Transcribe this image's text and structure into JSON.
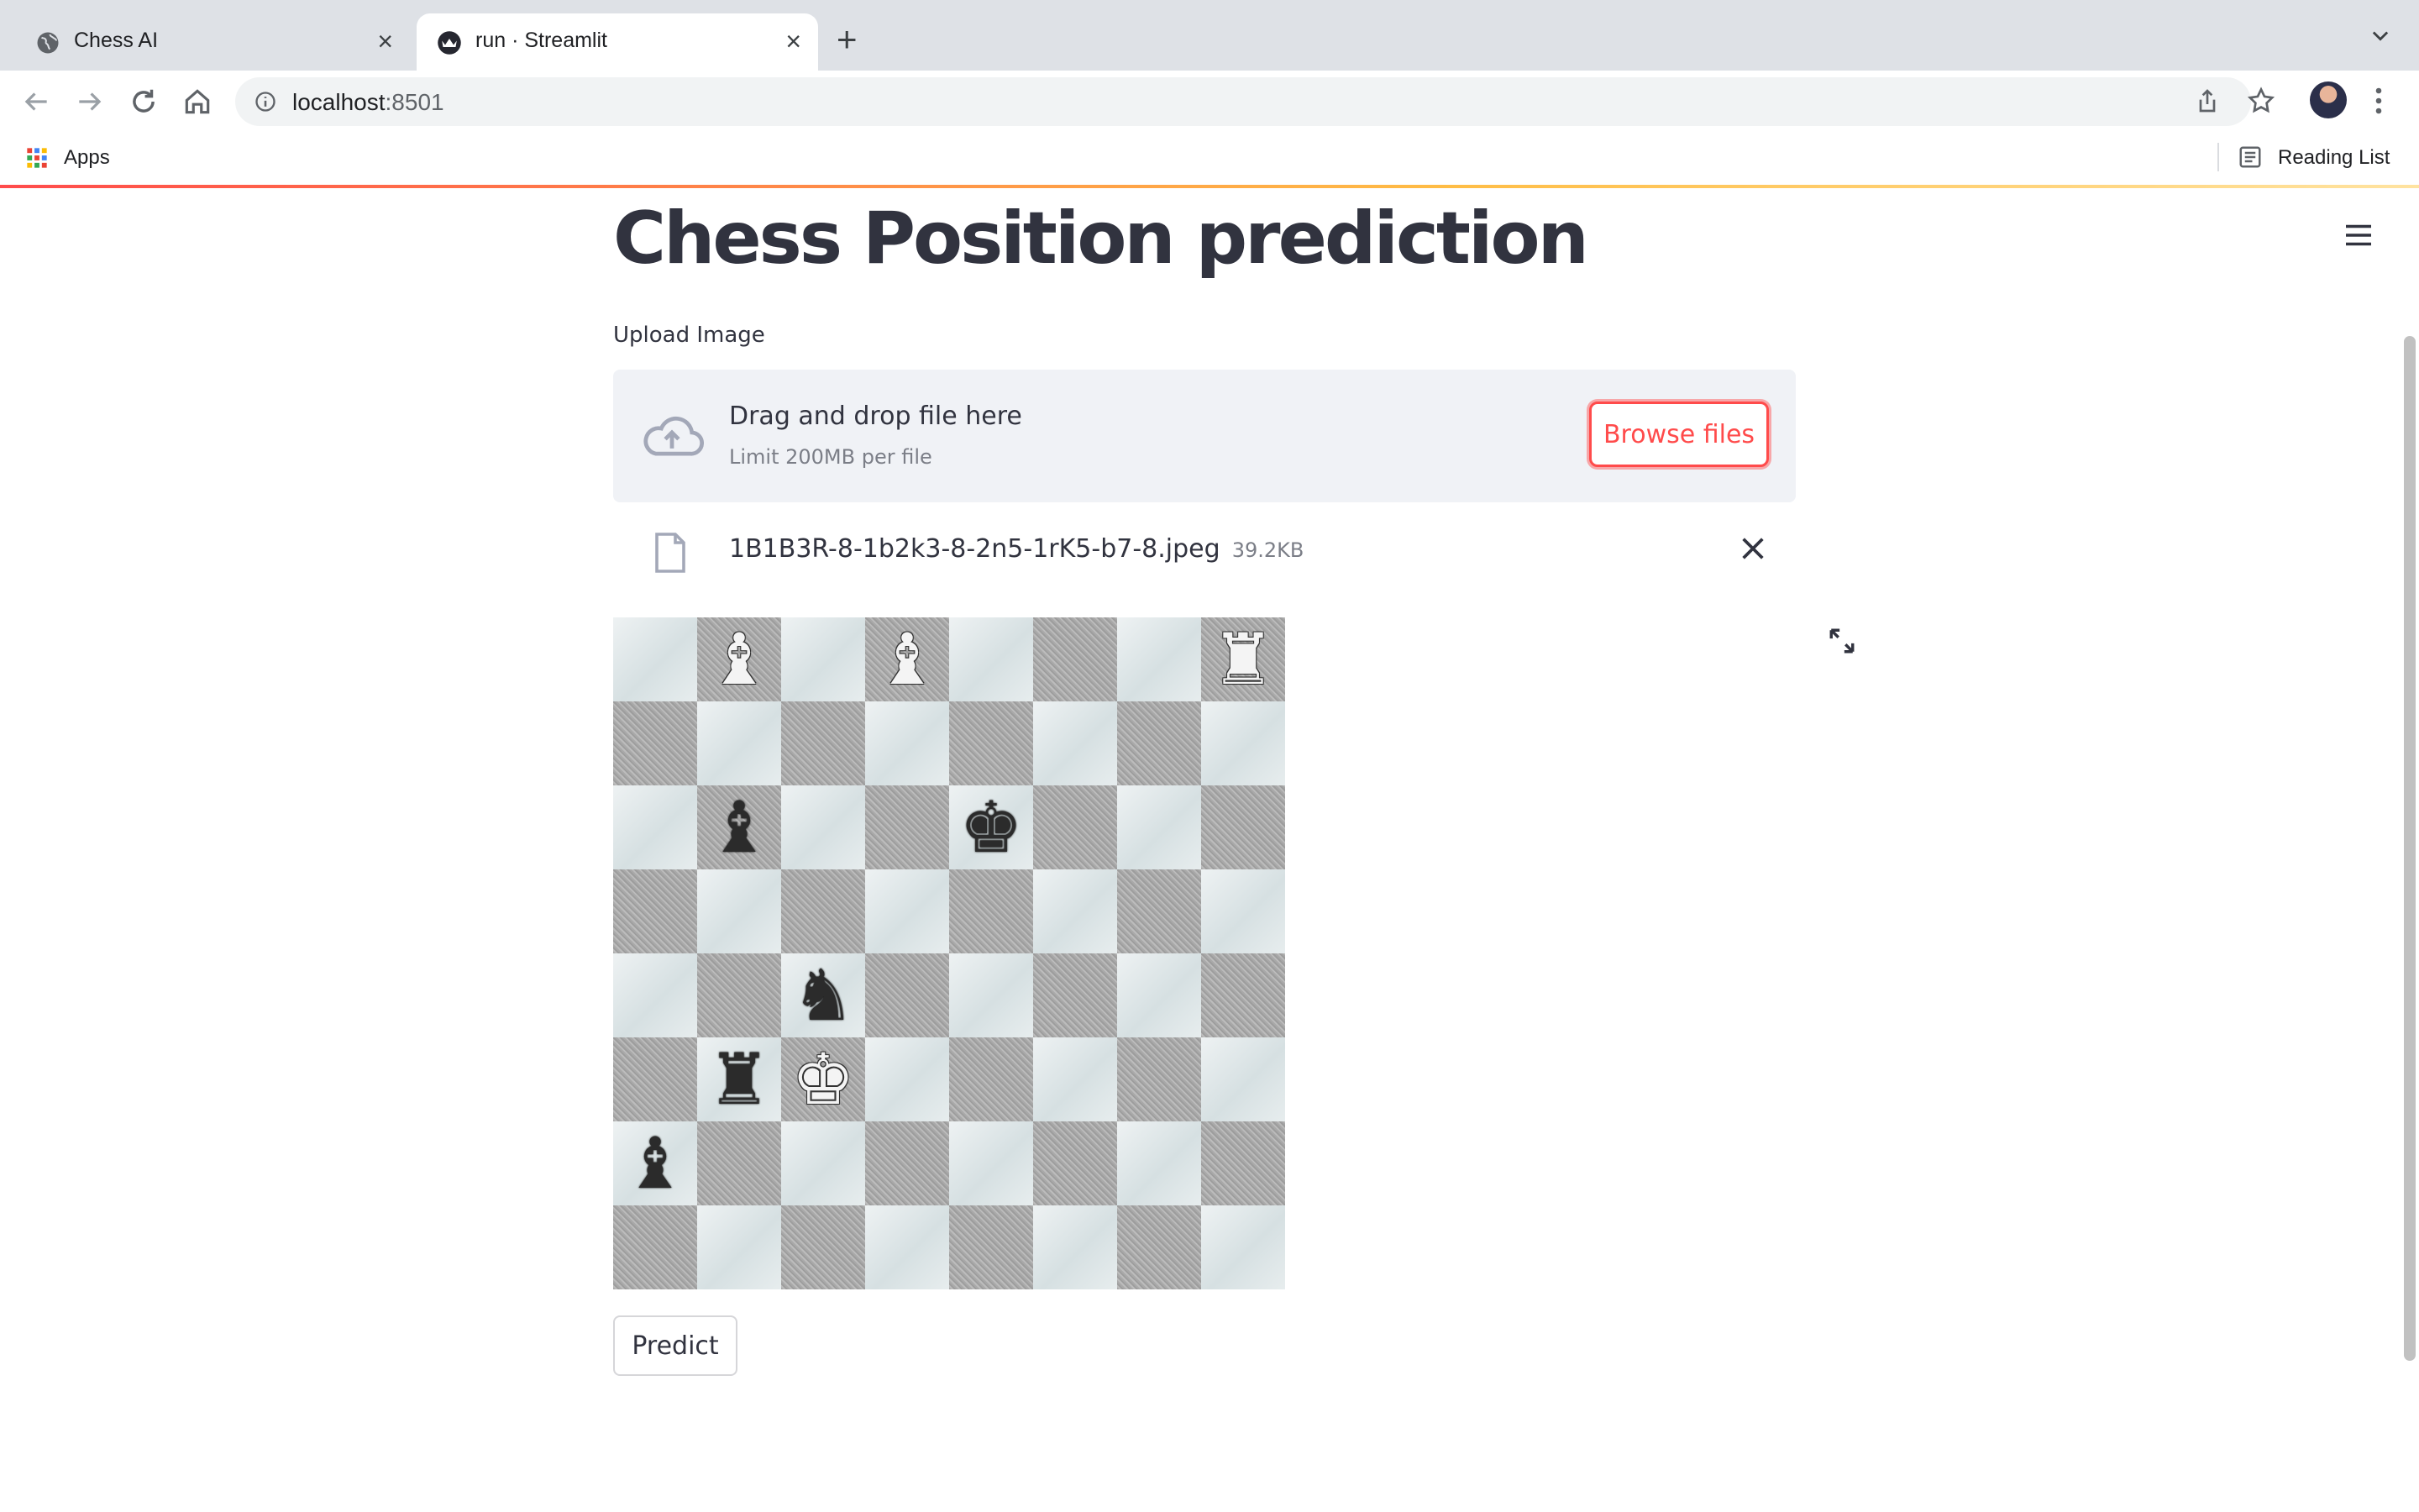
{
  "browser": {
    "tabs": [
      {
        "title": "Chess AI",
        "favicon": "globe-icon",
        "active": false
      },
      {
        "title": "run · Streamlit",
        "favicon": "streamlit-icon",
        "active": true
      }
    ],
    "url_host": "localhost",
    "url_port": ":8501",
    "bookmarks": {
      "apps_label": "Apps",
      "reading_list_label": "Reading List"
    }
  },
  "app": {
    "title": "Chess Position prediction",
    "uploader": {
      "label": "Upload Image",
      "drag_text": "Drag and drop file here",
      "limit_text": "Limit 200MB per file",
      "browse_label": "Browse files"
    },
    "uploaded_file": {
      "name": "1B1B3R-8-1b2k3-8-2n5-1rK5-b7-8.jpeg",
      "size": "39.2KB"
    },
    "board": {
      "fen": "1B1B3R/8/1b2k3/8/2n5/1rK5/b7/8",
      "rows": [
        [
          "",
          "B",
          "",
          "B",
          "",
          "",
          "",
          "R"
        ],
        [
          "",
          "",
          "",
          "",
          "",
          "",
          "",
          ""
        ],
        [
          "",
          "b",
          "",
          "",
          "k",
          "",
          "",
          ""
        ],
        [
          "",
          "",
          "",
          "",
          "",
          "",
          "",
          ""
        ],
        [
          "",
          "",
          "n",
          "",
          "",
          "",
          "",
          ""
        ],
        [
          "",
          "r",
          "K",
          "",
          "",
          "",
          "",
          ""
        ],
        [
          "b",
          "",
          "",
          "",
          "",
          "",
          "",
          ""
        ],
        [
          "",
          "",
          "",
          "",
          "",
          "",
          "",
          ""
        ]
      ]
    },
    "predict_label": "Predict"
  },
  "colors": {
    "accent": "#ff4b4b",
    "text": "#31333f",
    "dropzone_bg": "#f0f2f6"
  }
}
